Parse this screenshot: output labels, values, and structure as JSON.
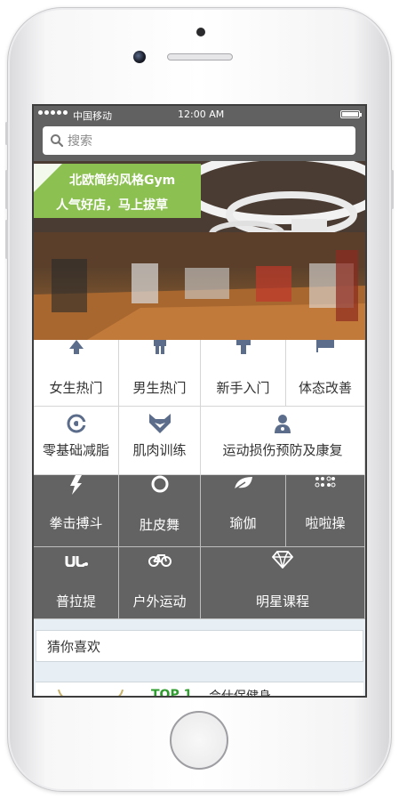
{
  "status": {
    "carrier": "中国移动",
    "time": "12:00 AM"
  },
  "search": {
    "placeholder": "搜索"
  },
  "banner": {
    "line1": "北欧简约风格Gym",
    "line2": "人气好店，马上拔草"
  },
  "categories": {
    "row1": [
      "女生热门",
      "男生热门",
      "新手入门",
      "体态改善"
    ],
    "row2": [
      "零基础减脂",
      "肌肉训练",
      "运动损伤预防及康复"
    ],
    "row3": [
      "拳击搏斗",
      "肚皮舞",
      "瑜伽",
      "啦啦操"
    ],
    "row4": [
      "普拉提",
      "户外运动",
      "明星课程"
    ]
  },
  "guess": {
    "title": "猜你喜欢"
  },
  "list": {
    "rank": "TOP 1",
    "name": "会仕保健身"
  },
  "colors": {
    "accent_green": "#8cc152",
    "dark_cell": "#636363",
    "status_bar": "#616161",
    "rank_green": "#2e9c2e"
  }
}
